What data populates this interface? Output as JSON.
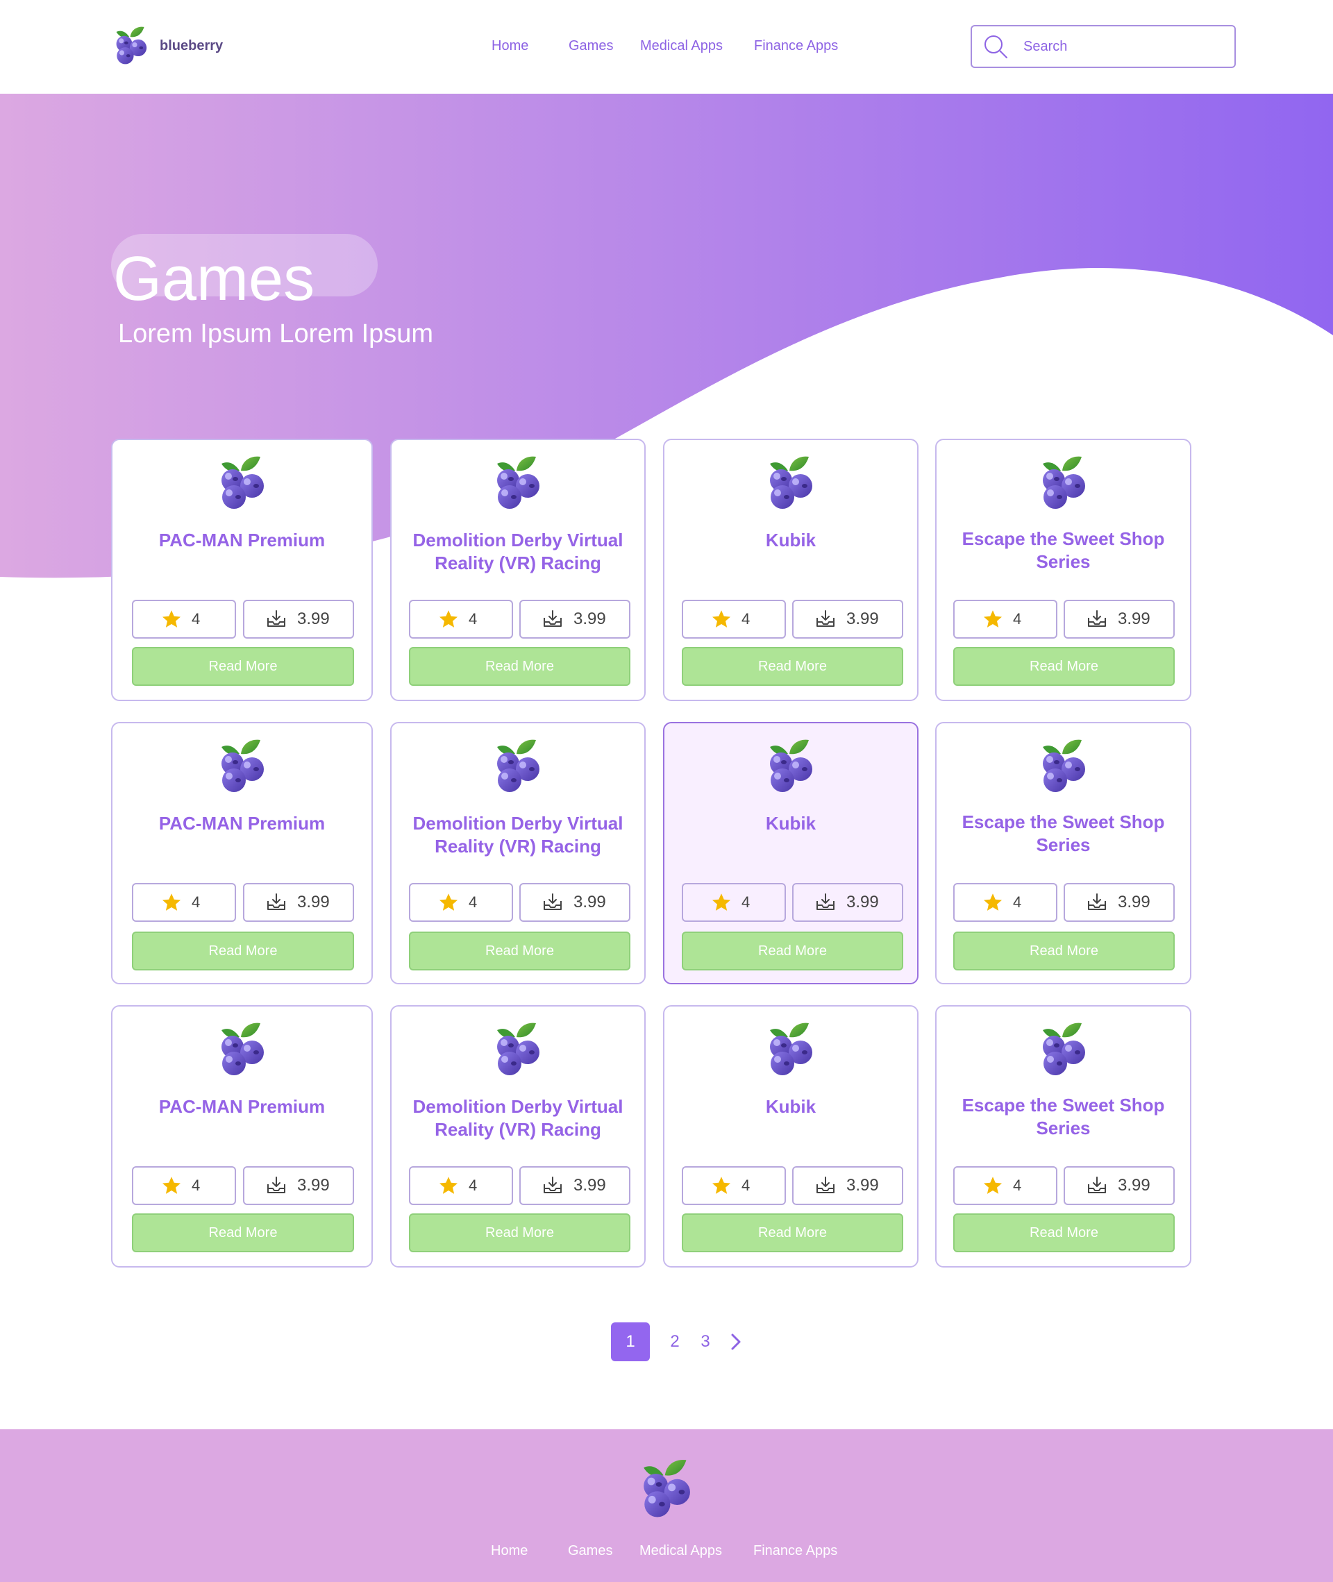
{
  "brand": {
    "name": "blueberry",
    "logo_icon": "blueberry-icon"
  },
  "nav": {
    "items": [
      "Home",
      "Games",
      "Medical Apps",
      "Finance Apps"
    ]
  },
  "search": {
    "placeholder": "Search",
    "icon": "search-icon"
  },
  "hero": {
    "title": "Games",
    "subtitle": "Lorem Ipsum Lorem Ipsum"
  },
  "cards": [
    {
      "title": "PAC-MAN Premium",
      "rating": "4",
      "price": "3.99",
      "button": "Read More"
    },
    {
      "title": "Demolition Derby Virtual Reality (VR) Racing",
      "rating": "4",
      "price": "3.99",
      "button": "Read More"
    },
    {
      "title": "Kubik",
      "rating": "4",
      "price": "3.99",
      "button": "Read More"
    },
    {
      "title": "Escape the Sweet Shop Series",
      "rating": "4",
      "price": "3.99",
      "button": "Read More"
    },
    {
      "title": "PAC-MAN Premium",
      "rating": "4",
      "price": "3.99",
      "button": "Read More"
    },
    {
      "title": "Demolition Derby Virtual Reality (VR) Racing",
      "rating": "4",
      "price": "3.99",
      "button": "Read More"
    },
    {
      "title": "Kubik",
      "rating": "4",
      "price": "3.99",
      "button": "Read More",
      "highlighted": true
    },
    {
      "title": "Escape the Sweet Shop Series",
      "rating": "4",
      "price": "3.99",
      "button": "Read More"
    },
    {
      "title": "PAC-MAN Premium",
      "rating": "4",
      "price": "3.99",
      "button": "Read More"
    },
    {
      "title": "Demolition Derby Virtual Reality (VR) Racing",
      "rating": "4",
      "price": "3.99",
      "button": "Read More"
    },
    {
      "title": "Kubik",
      "rating": "4",
      "price": "3.99",
      "button": "Read More"
    },
    {
      "title": "Escape the Sweet Shop Series",
      "rating": "4",
      "price": "3.99",
      "button": "Read More"
    }
  ],
  "pagination": {
    "current": "1",
    "pages": [
      "1",
      "2",
      "3"
    ],
    "next_icon": "chevron-right-icon"
  },
  "footer": {
    "nav": [
      "Home",
      "Games",
      "Medical Apps",
      "Finance Apps"
    ]
  },
  "colors": {
    "accent": "#9366ef",
    "nav_text": "#8d63e4",
    "hero_gradient_start": "#dca8e2",
    "hero_gradient_end": "#9166f0",
    "button_green": "#aee496",
    "footer_bg": "#dca8e2",
    "star": "#f5b800"
  }
}
